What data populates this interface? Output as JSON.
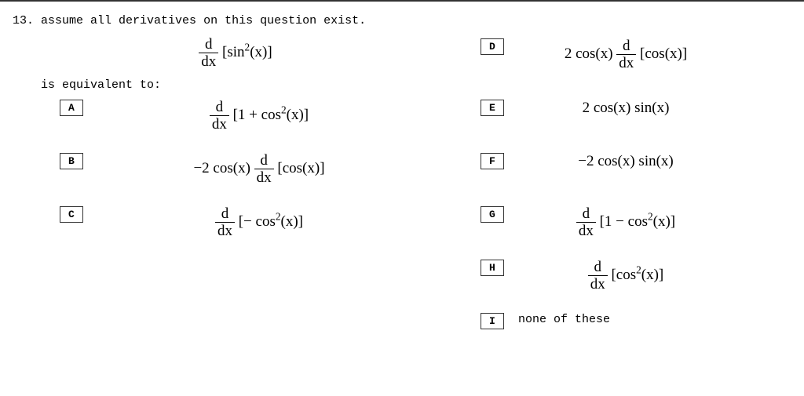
{
  "question": {
    "number": "13.",
    "prompt": "assume all derivatives on this question exist.",
    "main_expr_html": "<span class='frac'><span class='num'>d</span><span class='den'>dx</span></span> [sin<span class='sup'>2</span>(x)]",
    "equiv_text": "is equivalent to:"
  },
  "options": {
    "A": {
      "label": "A",
      "expr_html": "<span class='frac'><span class='num'>d</span><span class='den'>dx</span></span> [1 + cos<span class='sup'>2</span>(x)]"
    },
    "B": {
      "label": "B",
      "expr_html": "&minus;2 cos(x) <span class='frac'><span class='num'>d</span><span class='den'>dx</span></span> [cos(x)]"
    },
    "C": {
      "label": "C",
      "expr_html": "<span class='frac'><span class='num'>d</span><span class='den'>dx</span></span> [&minus; cos<span class='sup'>2</span>(x)]"
    },
    "D": {
      "label": "D",
      "expr_html": "2 cos(x) <span class='frac'><span class='num'>d</span><span class='den'>dx</span></span> [cos(x)]"
    },
    "E": {
      "label": "E",
      "expr_html": "2 cos(x) sin(x)"
    },
    "F": {
      "label": "F",
      "expr_html": "&minus;2 cos(x) sin(x)"
    },
    "G": {
      "label": "G",
      "expr_html": "<span class='frac'><span class='num'>d</span><span class='den'>dx</span></span> [1 &minus; cos<span class='sup'>2</span>(x)]"
    },
    "H": {
      "label": "H",
      "expr_html": "<span class='frac'><span class='num'>d</span><span class='den'>dx</span></span> [cos<span class='sup'>2</span>(x)]"
    },
    "I": {
      "label": "I",
      "text": "none of these"
    }
  }
}
